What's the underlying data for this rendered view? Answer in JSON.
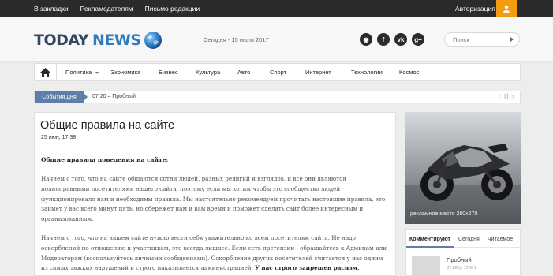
{
  "topbar": {
    "links": [
      "В закладки",
      "Рекламодателям",
      "Письмо редакции"
    ],
    "login": "Авторизация",
    "user_icon": "user-icon"
  },
  "header": {
    "logo_today": "TODAY",
    "logo_news": "NEWS",
    "date": "Сегодня - 15 июля 2017 г",
    "social": [
      {
        "name": "rss-icon",
        "glyph": "◉"
      },
      {
        "name": "facebook-icon",
        "glyph": "f"
      },
      {
        "name": "vk-icon",
        "glyph": "vk"
      },
      {
        "name": "google-plus-icon",
        "glyph": "g+"
      }
    ],
    "search_placeholder": "Поиск"
  },
  "nav": {
    "items": [
      "Политика",
      "Экономика",
      "Бизнес",
      "Культура",
      "Авто",
      "Спорт",
      "Интернет",
      "Технологии",
      "Космос"
    ]
  },
  "ticker": {
    "label": "События Дня",
    "text": "07:20 – Пробный",
    "controls": "‹ ǀǀ ›"
  },
  "article": {
    "title": "Общие правила на сайте",
    "meta": "25 июн, 17:38",
    "subtitle": "Общие правила поведения на сайте:",
    "p1": "Начнем с того, что на сайте общаются сотни людей, разных религий и взглядов, и все они являются полноправными посетителями нашего сайта, поэтому если мы хотим чтобы это сообщество людей функционировало нам и необходимы правила. Мы настоятельно рекомендуем прочитать настоящие правила, это займет у вас всего минут пять, но сбережет нам и вам время и поможет сделать сайт более интересным и организованным.",
    "p2_text": "Начнем с того, что на нашем сайте нужно вести себя уважительно ко всем посетителям сайта. Не надо оскорблений по отношению к участникам, это всегда лишнее. Если есть претензии - обращайтесь к Админам или Модераторам (воспользуйтесь личными сообщениями). Оскорбление других посетителей считается у нас одним из самых тяжких нарушений и строго наказывается администрацией.",
    "p2_bold": "У нас строго запрещен расизм,"
  },
  "sidebar": {
    "ad_text": "рекламное место 280x270",
    "tabs": [
      "Комментируют",
      "Сегодня",
      "Читаемое"
    ],
    "item_title": "Пробный",
    "item_stats": "07:20   ◎ 17   ✉ 0"
  },
  "colors": {
    "topbar": "#2b2b2b",
    "accent_orange": "#f39c12",
    "accent_blue": "#5c7ea8",
    "logo_dark": "#33495f",
    "logo_blue": "#2e7bbf"
  }
}
